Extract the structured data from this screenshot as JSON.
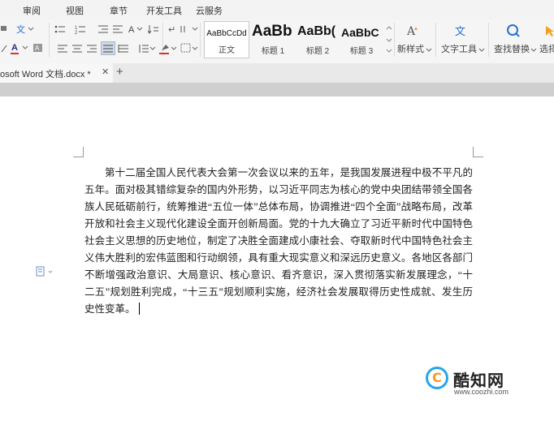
{
  "menu": {
    "tabs": [
      "审阅",
      "视图",
      "章节",
      "开发工具",
      "云服务"
    ]
  },
  "ribbon": {
    "styles": [
      {
        "sample": "AaBbCcDd",
        "label": "正文"
      },
      {
        "sample": "AaBb",
        "label": "标题 1"
      },
      {
        "sample": "AaBb(",
        "label": "标题 2"
      },
      {
        "sample": "AaBbC",
        "label": "标题 3"
      }
    ],
    "new_style_label": "新样式",
    "text_tools_label": "文字工具",
    "find_replace_label": "查找替换",
    "select_label": "选择",
    "font_color_glyph": "A",
    "sort_glyph": "A"
  },
  "tabbar": {
    "doc_title": "osoft Word 文档.docx *",
    "close_glyph": "✕",
    "new_tab_glyph": "+"
  },
  "document": {
    "paragraph": "第十二届全国人民代表大会第一次会议以来的五年，是我国发展进程中极不平凡的五年。面对极其错综复杂的国内外形势，以习近平同志为核心的党中央团结带领全国各族人民砥砺前行，统筹推进“五位一体”总体布局，协调推进“四个全面”战略布局，改革开放和社会主义现代化建设全面开创新局面。党的十九大确立了习近平新时代中国特色社会主义思想的历史地位，制定了决胜全面建成小康社会、夺取新时代中国特色社会主义伟大胜利的宏伟蓝图和行动纲领，具有重大现实意义和深远历史意义。各地区各部门不断增强政治意识、大局意识、核心意识、看齐意识，深入贯彻落实新发展理念，“十二五”规划胜利完成，“十三五”规划顺利实施，经济社会发展取得历史性成就、发生历史性变革。"
  },
  "watermark": {
    "logo_glyph": "C",
    "name": "酷知网",
    "url": "www.coozhi.com"
  },
  "colors": {
    "accent_red": "#e03030",
    "accent_blue": "#2b6fcf",
    "watermark_blue": "#29a6e6",
    "watermark_orange": "#f49b24"
  }
}
